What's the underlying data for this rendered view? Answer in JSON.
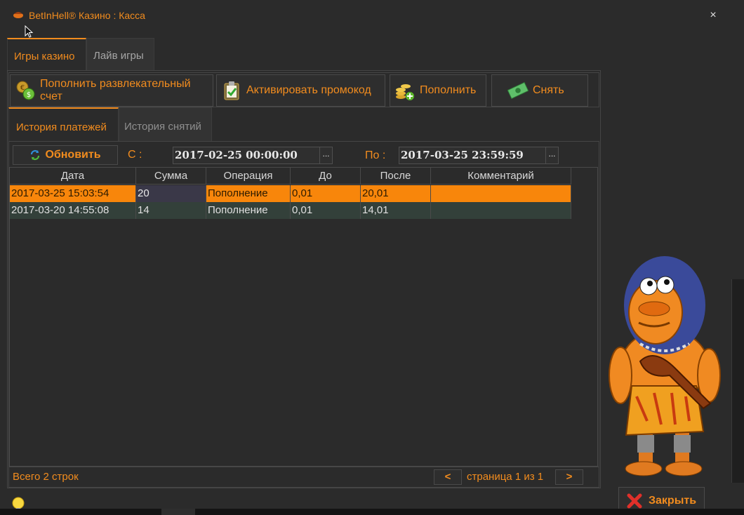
{
  "window": {
    "title": "BetInHell® Казино : Касса",
    "close_glyph": "×"
  },
  "top_tabs": [
    {
      "label": "Игры казино",
      "active": true
    },
    {
      "label": "Лайв игры",
      "active": false
    }
  ],
  "actions": [
    {
      "label": "Пополнить развлекательный счет",
      "icon": "coins-deposit-icon"
    },
    {
      "label": "Активировать промокод",
      "icon": "clipboard-check-icon"
    },
    {
      "label": "Пополнить",
      "icon": "coins-add-icon"
    },
    {
      "label": "Снять",
      "icon": "banknote-icon"
    }
  ],
  "sub_tabs": [
    {
      "label": "История платежей",
      "active": true
    },
    {
      "label": "История снятий",
      "active": false
    }
  ],
  "filter": {
    "refresh_label": "Обновить",
    "from_label": "С :",
    "from_value": "2017-02-25 00:00:00",
    "to_label": "По :",
    "to_value": "2017-03-25 23:59:59",
    "ellipsis": "..."
  },
  "table": {
    "columns": [
      "Дата",
      "Сумма",
      "Операция",
      "До",
      "После",
      "Комментарий"
    ],
    "rows": [
      [
        "2017-03-25 15:03:54",
        "20",
        "Пополнение",
        "0,01",
        "20,01",
        ""
      ],
      [
        "2017-03-20 14:55:08",
        "14",
        "Пополнение",
        "0,01",
        "14,01",
        ""
      ]
    ]
  },
  "footer": {
    "total": "Всего 2 строк",
    "prev": "<",
    "page": "страница 1 из 1",
    "next": ">"
  },
  "close_action": {
    "label": "Закрыть",
    "icon": "close-x-icon"
  },
  "colors": {
    "accent": "#f28c1e",
    "selected_row": "#f8860b",
    "background": "#2b2b2b"
  }
}
